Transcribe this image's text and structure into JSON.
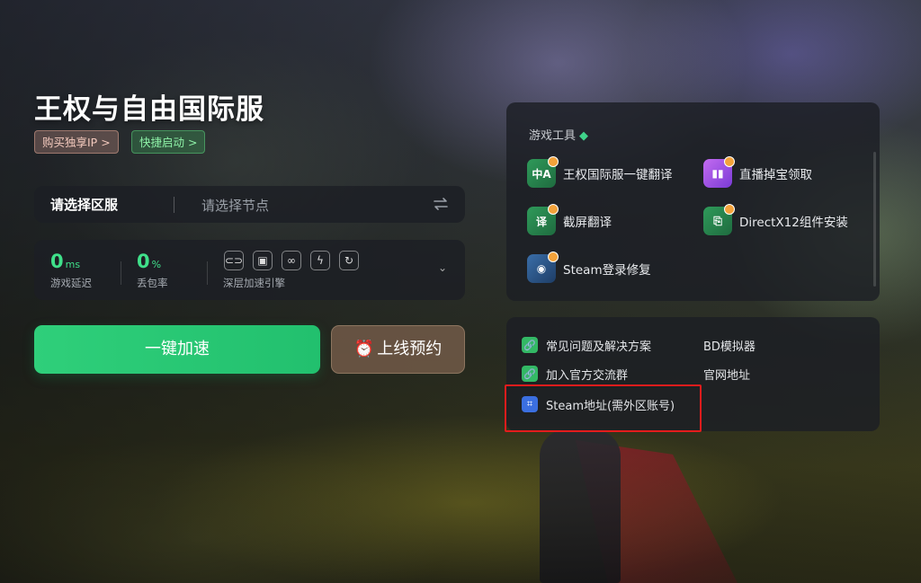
{
  "game": {
    "title": "王权与自由国际服",
    "tags": {
      "buy_ip": "购买独享IP >",
      "quick_start": "快捷启动 >"
    }
  },
  "region": {
    "server_placeholder": "请选择区服",
    "node_placeholder": "请选择节点"
  },
  "stats": {
    "latency_value": "0",
    "latency_unit": "ms",
    "latency_label": "游戏延迟",
    "loss_value": "0",
    "loss_unit": "%",
    "loss_label": "丢包率",
    "engine_label": "深层加速引擎",
    "engine_icons": [
      "link-icon",
      "window-icon",
      "rings-icon",
      "bolt-icon",
      "refresh-icon"
    ]
  },
  "actions": {
    "accelerate": "一键加速",
    "reserve": "上线预约",
    "reserve_icon": "alarm-clock-icon"
  },
  "tools": {
    "title": "游戏工具",
    "items": [
      {
        "label": "王权国际服一键翻译",
        "icon": "translate-icon"
      },
      {
        "label": "直播掉宝领取",
        "icon": "twitch-drops-icon"
      },
      {
        "label": "截屏翻译",
        "icon": "screenshot-translate-icon"
      },
      {
        "label": "DirectX12组件安装",
        "icon": "directx-install-icon"
      },
      {
        "label": "Steam登录修复",
        "icon": "steam-repair-icon"
      }
    ]
  },
  "links": {
    "items": [
      {
        "label": "常见问题及解决方案",
        "icon": "link-icon"
      },
      {
        "label": "BD模拟器",
        "icon": ""
      },
      {
        "label": "加入官方交流群",
        "icon": "link-icon"
      },
      {
        "label": "官网地址",
        "icon": ""
      },
      {
        "label": "Steam地址(需外区账号)",
        "icon": "steam-link-icon"
      }
    ]
  },
  "colors": {
    "accent_green": "#2fcf7a",
    "highlight_red": "#e41c1c",
    "stat_green": "#3fe08a"
  }
}
